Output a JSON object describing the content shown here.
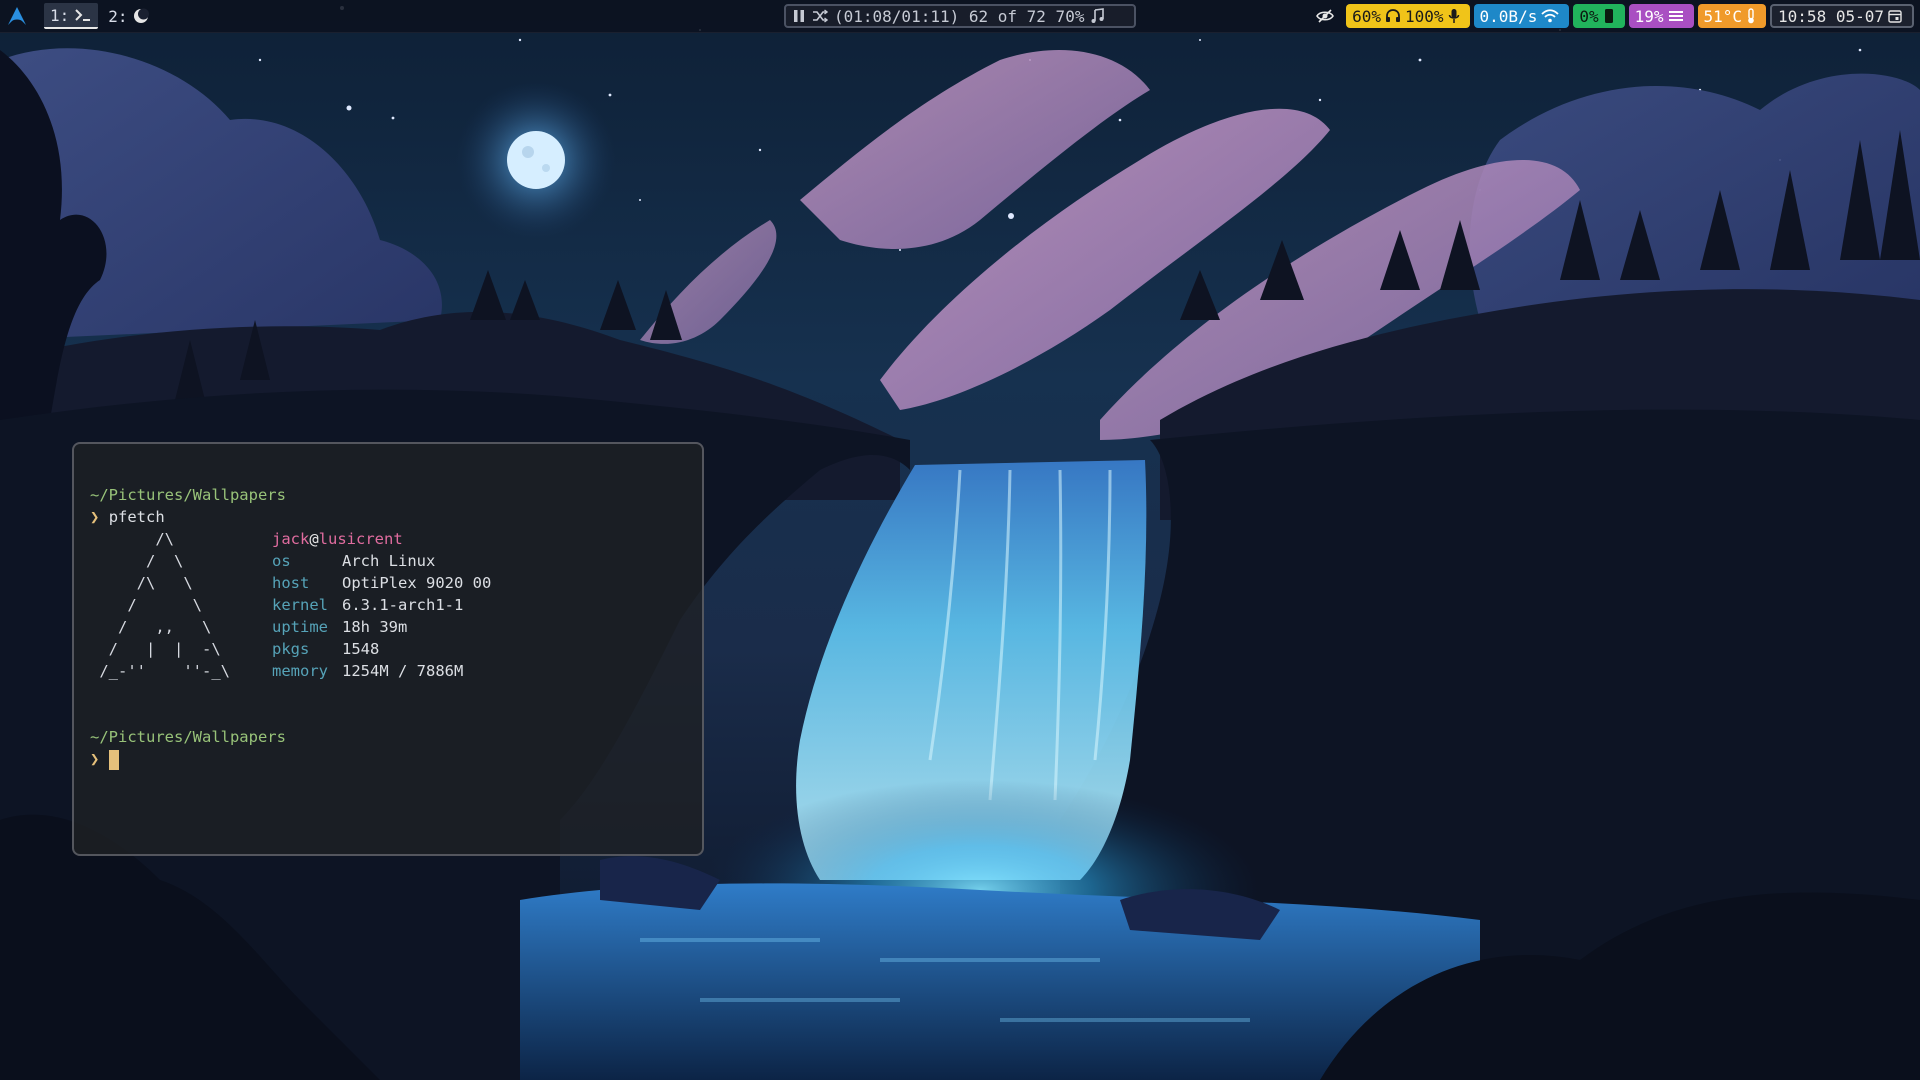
{
  "topbar": {
    "workspaces": [
      {
        "number": "1:",
        "icon": "terminal-icon",
        "active": true
      },
      {
        "number": "2:",
        "icon": "moon-icon",
        "active": false
      }
    ],
    "media": {
      "status_icons": [
        "pause-icon",
        "shuffle-icon"
      ],
      "text": "(01:08/01:11) 62 of 72 70%",
      "trailing_icon": "music-note-icon"
    },
    "modules": {
      "idle_icon": "eye-off-icon",
      "volume": "60%",
      "headphone_volume": "100%",
      "mic_icon": "microphone-icon",
      "network_speed": "0.0B/s",
      "wifi_icon": "wifi-icon",
      "cpu": "0%",
      "cpu_icon": "chip-icon",
      "memory": "19%",
      "memory_icon": "memory-bars-icon",
      "temperature": "51°C",
      "temp_icon": "thermometer-icon",
      "clock": "10:58 05-07",
      "calendar_icon": "calendar-icon"
    },
    "colors": {
      "audio": "#f0c419",
      "network": "#1e88c8",
      "cpu": "#21b35c",
      "memory": "#a94fc2",
      "temperature": "#f09a2a"
    }
  },
  "terminal": {
    "cwd1": "~/Pictures/Wallpapers",
    "prompt": "❯",
    "command": "pfetch",
    "logo": [
      "       /\\",
      "      /  \\",
      "     /\\   \\",
      "    /      \\",
      "   /   ,,   \\",
      "  /   |  |  -\\",
      " /_-''    ''-_\\"
    ],
    "user": "jack",
    "at": "@",
    "host": "lusicrent",
    "info": [
      {
        "key": "os",
        "value": "Arch Linux"
      },
      {
        "key": "host",
        "value": "OptiPlex 9020 00"
      },
      {
        "key": "kernel",
        "value": "6.3.1-arch1-1"
      },
      {
        "key": "uptime",
        "value": "18h 39m"
      },
      {
        "key": "pkgs",
        "value": "1548"
      },
      {
        "key": "memory",
        "value": "1254M / 7886M"
      }
    ],
    "cwd2": "~/Pictures/Wallpapers",
    "prompt2": "❯"
  }
}
